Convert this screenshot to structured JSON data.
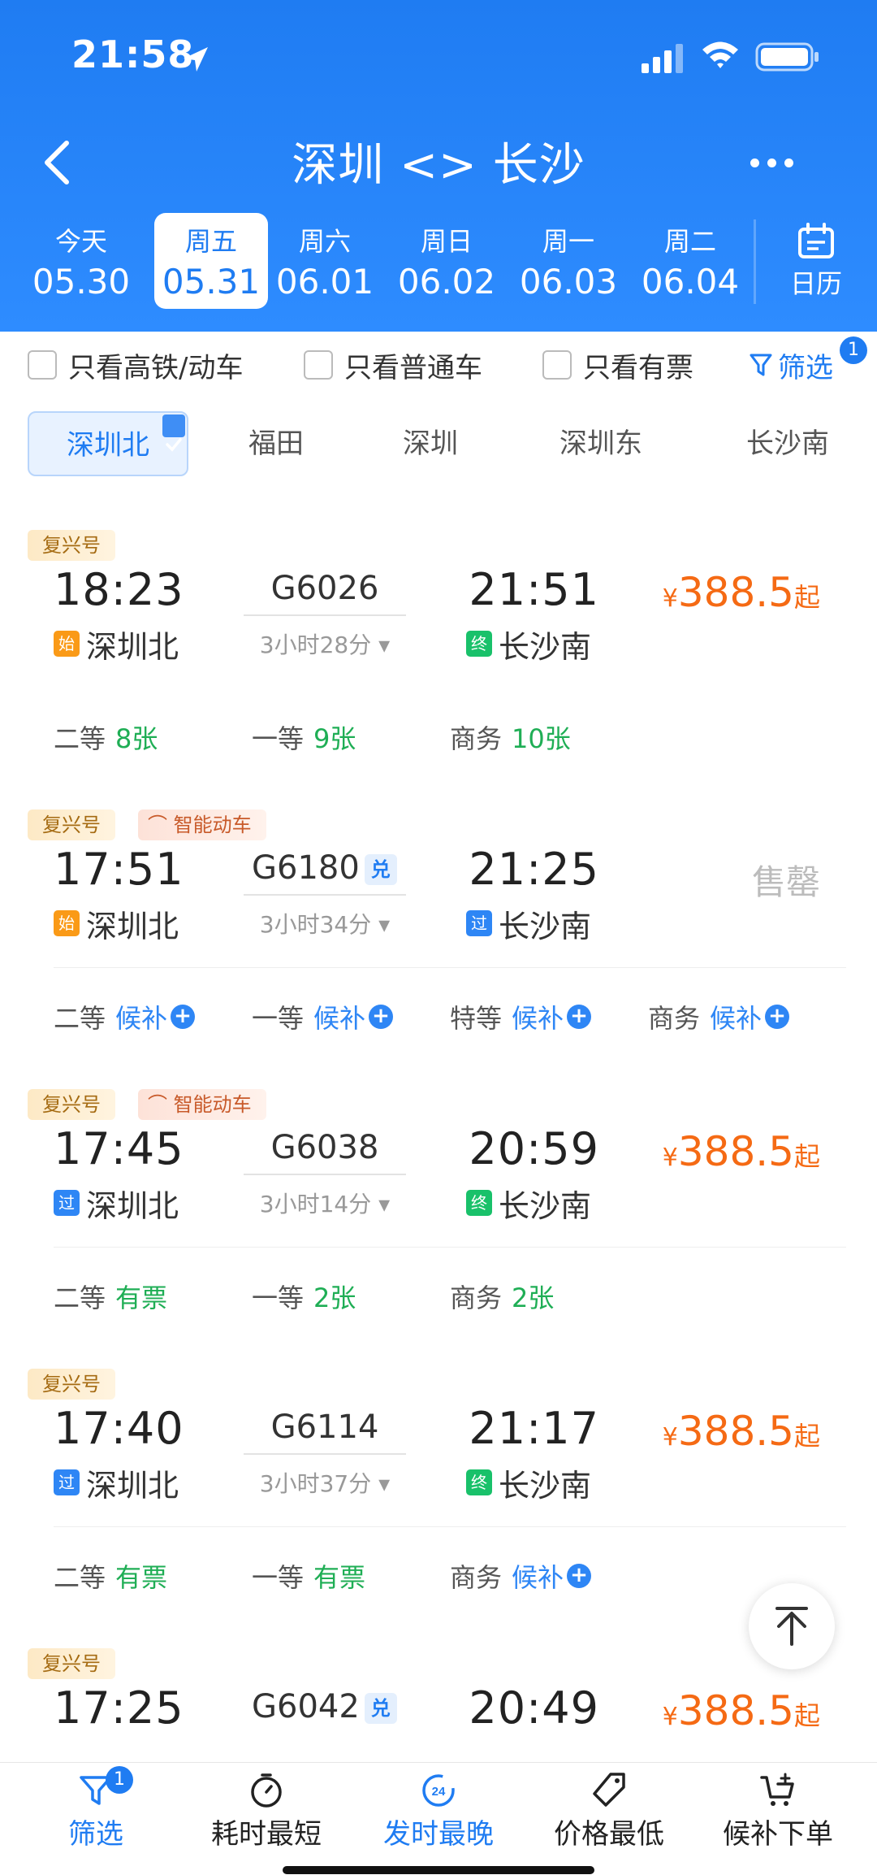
{
  "status_bar": {
    "time": "21:58"
  },
  "nav": {
    "title": "深圳 <> 长沙"
  },
  "dates": [
    {
      "dow": "今天",
      "md": "05.30"
    },
    {
      "dow": "周五",
      "md": "05.31"
    },
    {
      "dow": "周六",
      "md": "06.01"
    },
    {
      "dow": "周日",
      "md": "06.02"
    },
    {
      "dow": "周一",
      "md": "06.03"
    },
    {
      "dow": "周二",
      "md": "06.04"
    }
  ],
  "selected_date_index": 1,
  "calendar_label": "日历",
  "filters": {
    "gaotie": "只看高铁/动车",
    "putong": "只看普通车",
    "youpiao": "只看有票",
    "filter_label": "筛选",
    "filter_count": "1"
  },
  "stations": [
    "深圳北",
    "福田",
    "深圳",
    "深圳东",
    "长沙南"
  ],
  "selected_station_index": 0,
  "trains": [
    {
      "tags": [
        "复兴号"
      ],
      "dep_time": "18:23",
      "train_no": "G6026",
      "arr_time": "21:51",
      "duration": "3小时28分",
      "dep_station": "深圳北",
      "dep_mark": "始",
      "arr_station": "长沙南",
      "arr_mark": "终",
      "price_symbol": "¥",
      "price": "388.5",
      "price_suffix": "起",
      "seats": [
        {
          "class": "二等",
          "avail": "8张"
        },
        {
          "class": "一等",
          "avail": "9张"
        },
        {
          "class": "商务",
          "avail": "10张"
        }
      ]
    },
    {
      "tags": [
        "复兴号",
        "智能动车"
      ],
      "dep_time": "17:51",
      "train_no": "G6180",
      "badge": "兑",
      "arr_time": "21:25",
      "duration": "3小时34分",
      "dep_station": "深圳北",
      "dep_mark": "始",
      "arr_station": "长沙南",
      "arr_mark": "过",
      "status": "售罄",
      "seats": [
        {
          "class": "二等",
          "avail": "候补"
        },
        {
          "class": "一等",
          "avail": "候补"
        },
        {
          "class": "特等",
          "avail": "候补"
        },
        {
          "class": "商务",
          "avail": "候补"
        }
      ]
    },
    {
      "tags": [
        "复兴号",
        "智能动车"
      ],
      "dep_time": "17:45",
      "train_no": "G6038",
      "arr_time": "20:59",
      "duration": "3小时14分",
      "dep_station": "深圳北",
      "dep_mark": "过",
      "arr_station": "长沙南",
      "arr_mark": "终",
      "price_symbol": "¥",
      "price": "388.5",
      "price_suffix": "起",
      "seats": [
        {
          "class": "二等",
          "avail": "有票"
        },
        {
          "class": "一等",
          "avail": "2张"
        },
        {
          "class": "商务",
          "avail": "2张"
        }
      ]
    },
    {
      "tags": [
        "复兴号"
      ],
      "dep_time": "17:40",
      "train_no": "G6114",
      "arr_time": "21:17",
      "duration": "3小时37分",
      "dep_station": "深圳北",
      "dep_mark": "过",
      "arr_station": "长沙南",
      "arr_mark": "终",
      "price_symbol": "¥",
      "price": "388.5",
      "price_suffix": "起",
      "seats": [
        {
          "class": "二等",
          "avail": "有票"
        },
        {
          "class": "一等",
          "avail": "有票"
        },
        {
          "class": "商务",
          "avail": "候补"
        }
      ]
    },
    {
      "tags": [
        "复兴号"
      ],
      "dep_time": "17:25",
      "train_no": "G6042",
      "badge": "兑",
      "arr_time": "20:49",
      "price_symbol": "¥",
      "price": "388.5",
      "price_suffix": "起"
    }
  ],
  "bottom_bar": {
    "filter": "筛选",
    "filter_count": "1",
    "shortest": "耗时最短",
    "latest": "发时最晚",
    "latest_icon_text": "24",
    "cheapest": "价格最低",
    "waitlist": "候补下单"
  },
  "colors": {
    "brand_blue": "#1f7cf2",
    "price_orange": "#f56a14",
    "available_green": "#1fae55",
    "waitlist_blue": "#2e86f5"
  }
}
